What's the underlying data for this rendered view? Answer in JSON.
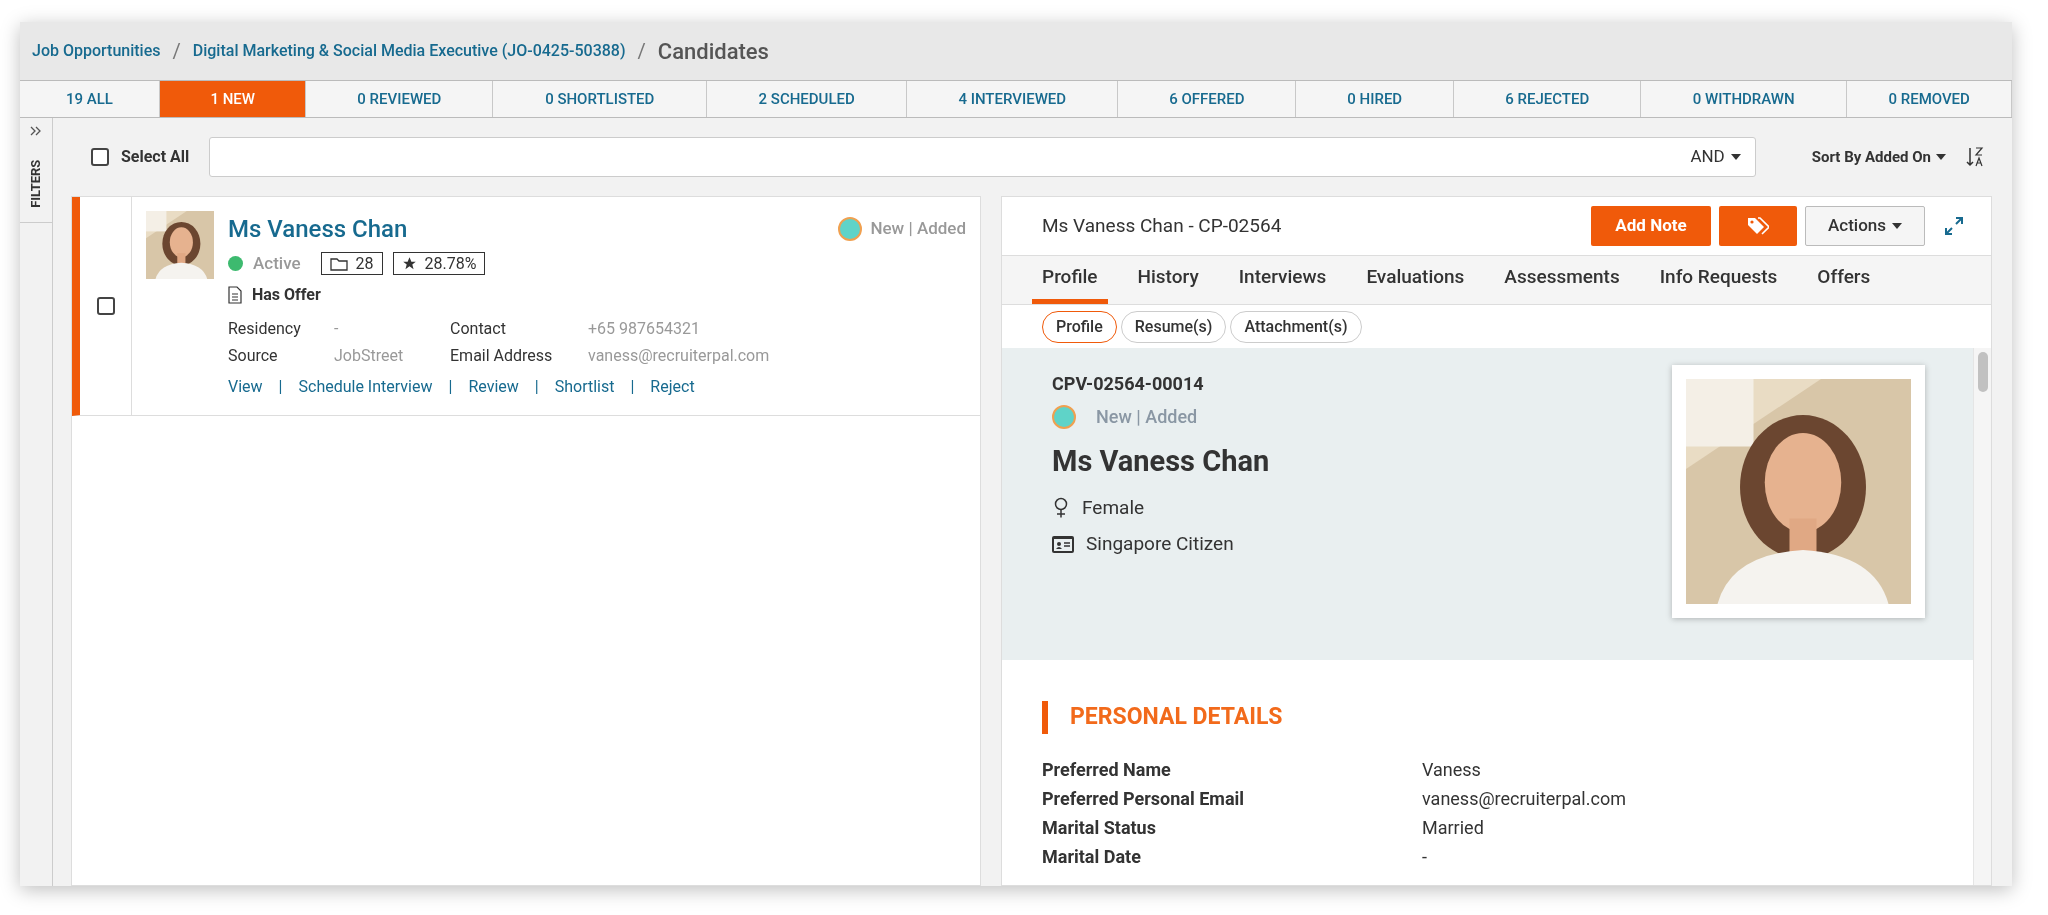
{
  "breadcrumb_separator": "/",
  "breadcrumb": [
    {
      "label": "Job Opportunities",
      "kind": "link"
    },
    {
      "label": "Digital Marketing & Social Media Executive (JO-0425-50388)",
      "kind": "link"
    },
    {
      "label": "Candidates",
      "kind": "current"
    }
  ],
  "status_tabs": [
    {
      "label": "19 ALL",
      "selected": false
    },
    {
      "label": "1 NEW",
      "selected": true
    },
    {
      "label": "0 REVIEWED",
      "selected": false
    },
    {
      "label": "0 SHORTLISTED",
      "selected": false
    },
    {
      "label": "2 SCHEDULED",
      "selected": false
    },
    {
      "label": "4 INTERVIEWED",
      "selected": false
    },
    {
      "label": "6 OFFERED",
      "selected": false
    },
    {
      "label": "0 HIRED",
      "selected": false
    },
    {
      "label": "6 REJECTED",
      "selected": false
    },
    {
      "label": "0 WITHDRAWN",
      "selected": false
    },
    {
      "label": "0 REMOVED",
      "selected": false
    }
  ],
  "filters": {
    "label": "FILTERS"
  },
  "toolbar": {
    "select_all": {
      "label": "Select All",
      "checked": false
    },
    "search": {
      "operator": "AND"
    },
    "sort": {
      "label": "Sort By Added On"
    }
  },
  "candidates": [
    {
      "name": "Ms Vaness Chan",
      "selected": true,
      "checked": false,
      "status": {
        "label": "Active",
        "color": "#3dba6f"
      },
      "folders": "28",
      "score": "28.78%",
      "offer": "Has Offer",
      "stage": {
        "label": "New | Added",
        "color": "#5fd3c8"
      },
      "fields": [
        {
          "label": "Residency",
          "value": "-"
        },
        {
          "label": "Contact",
          "value": "+65 987654321"
        },
        {
          "label": "Source",
          "value": "JobStreet"
        },
        {
          "label": "Email Address",
          "value": "vaness@recruiterpal.com"
        }
      ],
      "action_separator": "|",
      "actions": [
        "View",
        "Schedule Interview",
        "Review",
        "Shortlist",
        "Reject"
      ]
    }
  ],
  "detail": {
    "title": "Ms Vaness Chan - CP-02564",
    "add_note": "Add Note",
    "actions": "Actions",
    "tabs": [
      {
        "label": "Profile",
        "selected": true
      },
      {
        "label": "History",
        "selected": false
      },
      {
        "label": "Interviews",
        "selected": false
      },
      {
        "label": "Evaluations",
        "selected": false
      },
      {
        "label": "Assessments",
        "selected": false
      },
      {
        "label": "Info Requests",
        "selected": false
      },
      {
        "label": "Offers",
        "selected": false
      }
    ],
    "subtabs": [
      {
        "label": "Profile",
        "selected": true
      },
      {
        "label": "Resume(s)",
        "selected": false
      },
      {
        "label": "Attachment(s)",
        "selected": false
      }
    ],
    "code": "CPV-02564-00014",
    "stage": {
      "label": "New | Added",
      "color": "#5fd3c8"
    },
    "name": "Ms Vaness Chan",
    "gender": "Female",
    "residency": "Singapore Citizen",
    "section_title": "PERSONAL DETAILS",
    "details": [
      {
        "label": "Preferred Name",
        "value": "Vaness"
      },
      {
        "label": "Preferred Personal Email",
        "value": "vaness@recruiterpal.com"
      },
      {
        "label": "Marital Status",
        "value": "Married"
      },
      {
        "label": "Marital Date",
        "value": "-"
      }
    ]
  }
}
